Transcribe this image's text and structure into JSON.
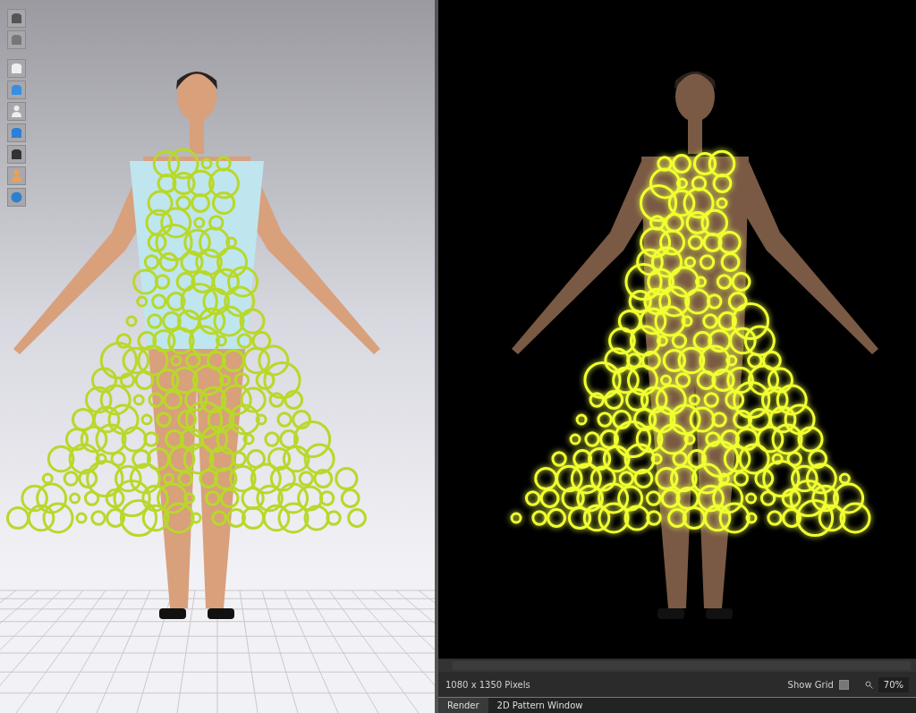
{
  "render_view": {
    "size_label": "1080 x 1350 Pixels",
    "show_grid": {
      "label": "Show Grid",
      "checked": false
    },
    "zoom": "70%"
  },
  "tabs": [
    {
      "label": "Render",
      "selected": true
    },
    {
      "label": "2D Pattern Window",
      "selected": false
    }
  ]
}
